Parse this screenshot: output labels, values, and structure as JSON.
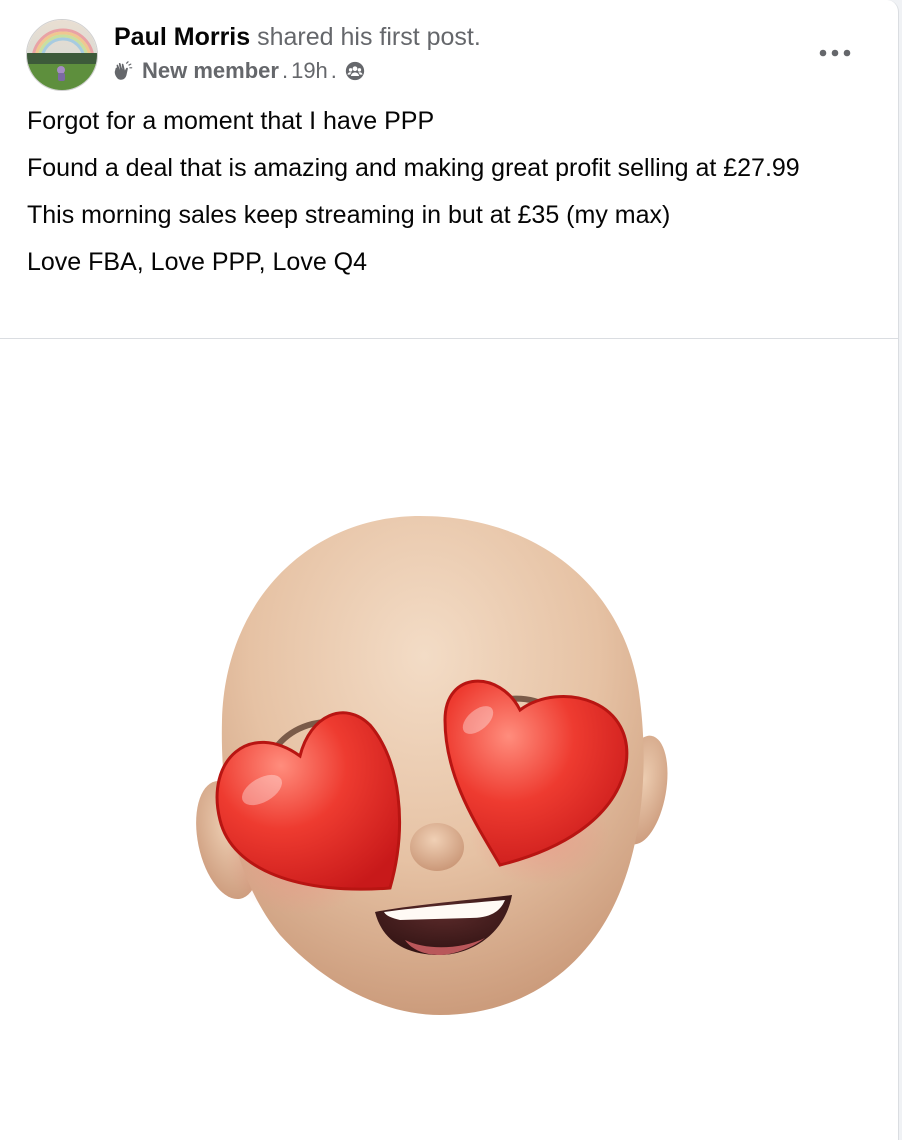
{
  "post": {
    "author_name": "Paul Morris",
    "action_text": "shared his first post.",
    "badge_icon": "waving-hand-icon",
    "badge_label": "New member",
    "separator": ".",
    "time": "19h",
    "privacy_icon": "group-audience-icon",
    "more_icon": "more-options-icon",
    "paragraphs": [
      "Forgot for a moment that I have PPP",
      "Found a deal that is amazing and making great profit selling at £27.99",
      "This morning sales keep streaming in but at £35 (my max)",
      "Love FBA, Love PPP, Love Q4"
    ],
    "media": {
      "subject": "heart-eyes-memoji",
      "background_color": "#ffffff"
    }
  },
  "colors": {
    "card_background": "#ffffff",
    "secondary_text": "#65676b",
    "primary_text": "#050505",
    "divider": "#dadde1",
    "heart_red": "#e8312a"
  }
}
